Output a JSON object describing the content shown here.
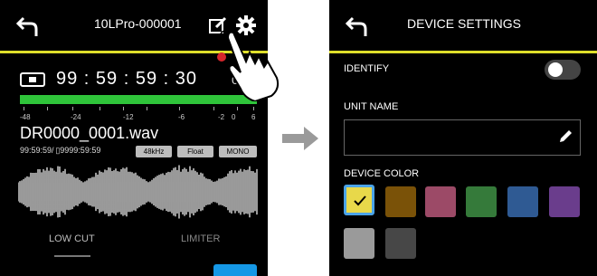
{
  "left_screen": {
    "title": "10LPro-000001",
    "timecode": "99 : 59 : 59 : 30",
    "timecode_suffix": "0",
    "meter_scale": [
      "-48",
      "-24",
      "-12",
      "-6",
      "-2",
      "0",
      "6"
    ],
    "file_name": "DR0000_0001.wav",
    "file_info": "99:59:59/ ▯9999:59:59",
    "tags": [
      "48kHz",
      "Float",
      "MONO"
    ],
    "buttons": {
      "low_cut": "LOW CUT",
      "limiter": "LIMITER"
    },
    "icons": [
      "back-arrow-icon",
      "edit-icon",
      "gear-icon",
      "stop-icon",
      "hand-tap-icon"
    ]
  },
  "right_screen": {
    "title": "DEVICE SETTINGS",
    "identify_label": "IDENTIFY",
    "identify_on": false,
    "unit_name_label": "UNIT NAME",
    "unit_name_value": "",
    "device_color_label": "DEVICE COLOR",
    "colors": [
      "#e8d84a",
      "#7a5208",
      "#9c4a67",
      "#357a3a",
      "#2f5a93",
      "#6a3d8c",
      "#9a9a9a",
      "#474747"
    ],
    "selected_color_index": 0
  },
  "colors": {
    "accent_line": "#dede2a",
    "meter": "#2fc43a",
    "blue_button": "#1598e6"
  }
}
